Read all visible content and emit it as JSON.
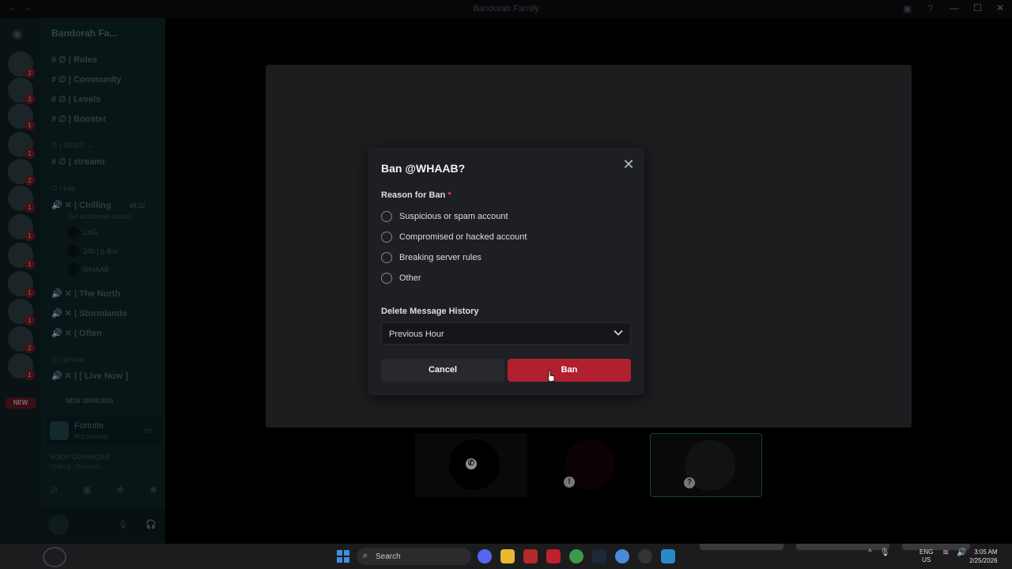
{
  "window": {
    "title": "Bandorah Family",
    "controls": [
      "—",
      "☐",
      "✕"
    ]
  },
  "server": {
    "name": "Bandorah Fa...",
    "channels": [
      {
        "name": "Roles"
      },
      {
        "name": "Community"
      },
      {
        "name": "Levels"
      },
      {
        "name": "Booster"
      },
      {
        "name": "streamr"
      }
    ],
    "categories": [
      "NEWS",
      "pap",
      "private"
    ],
    "voice_channels": [
      {
        "name": "Chilling",
        "timer": "48:32",
        "status": "Set a channel status"
      },
      {
        "name": "The North"
      },
      {
        "name": "Stormlands"
      },
      {
        "name": "Often"
      },
      {
        "name": "[ Live Now ]"
      }
    ],
    "voice_users": [
      "LNG",
      "24h | ρ Bnr.",
      "WHAAB"
    ],
    "new_unreads": "NEW UNREADS",
    "new_badge": "NEW"
  },
  "activity": {
    "game": "Fortnite",
    "sub": "Not Sharing"
  },
  "voice": {
    "status": "Voice Connected",
    "channel": "Chilling / Bandora..."
  },
  "rail_badges": [
    "2",
    "3",
    "1",
    "1",
    "2",
    "1",
    "1",
    "1",
    "1",
    "1",
    "2",
    "1",
    "1"
  ],
  "modal": {
    "title": "Ban @WHAAB?",
    "reason_label": "Reason for Ban",
    "required_mark": "*",
    "reasons": [
      "Suspicious or spam account",
      "Compromised or hacked account",
      "Breaking server rules",
      "Other"
    ],
    "history_label": "Delete Message History",
    "history_value": "Previous Hour",
    "cancel": "Cancel",
    "ban": "Ban",
    "ban_color": "#b1202f"
  },
  "taskbar": {
    "search": "Search",
    "lang_top": "ENG",
    "lang_bottom": "US",
    "time": "3:05 AM",
    "date": "2/25/2026"
  }
}
